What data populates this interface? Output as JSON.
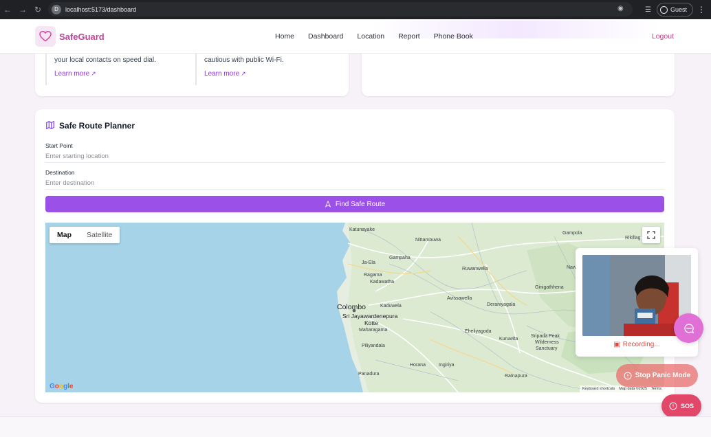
{
  "browser": {
    "url": "localhost:5173/dashboard",
    "profile_label": "Guest",
    "site_icon_letter": "D"
  },
  "header": {
    "brand": "SafeGuard",
    "nav": [
      "Home",
      "Dashboard",
      "Location",
      "Report",
      "Phone Book"
    ],
    "logout": "Logout",
    "brand_color": "#c2459c",
    "accent_color": "#9333ea"
  },
  "tips": [
    {
      "text": "your local contacts on speed dial.",
      "link": "Learn more"
    },
    {
      "text": "cautious with public Wi-Fi.",
      "link": "Learn more"
    }
  ],
  "planner": {
    "title": "Safe Route Planner",
    "start_label": "Start Point",
    "start_placeholder": "Enter starting location",
    "start_value": "",
    "dest_label": "Destination",
    "dest_placeholder": "Enter destination",
    "dest_value": "",
    "find_button": "Find Safe Route",
    "button_color": "#9b51e8"
  },
  "map": {
    "tabs": [
      "Map",
      "Satellite"
    ],
    "active_tab": "Map",
    "places": {
      "katunayake": "Katunayake",
      "nittambuwa": "Nittambuwa",
      "gampaha": "Gampaha",
      "ja_ela": "Ja-Ela",
      "ragama": "Ragama",
      "kadawatha": "Kadawatha",
      "ruwanwella": "Ruwanwella",
      "gampola": "Gampola",
      "rikillag": "Rikillag",
      "nawalapitiya": "Nawalapitiya",
      "ginigathhena": "Ginigathhena",
      "avissawella": "Avissawella",
      "deraniyagala": "Deraniyagala",
      "kaduwela": "Kaduwela",
      "colombo": "Colombo",
      "sri_jayawardenepura": "Sri Jayawardenepura",
      "kotte": "Kotte",
      "maharagama": "Maharagama",
      "eheliyagoda": "Eheliyagoda",
      "kuruwita": "Kuruwita",
      "sripada": "Sripada Peak",
      "wilderness": "Wilderness",
      "sanctuary": "Sanctuary",
      "piliyandala": "Piliyandala",
      "ingiriya": "Ingiriya",
      "horana": "Horana",
      "panadura": "Panadura",
      "ratnapura": "Ratnapura"
    },
    "google_logo": "Google",
    "attribution": [
      "Keyboard shortcuts",
      "Map data ©2025",
      "Terms"
    ],
    "water_color": "#a6d3e8",
    "land_color": "#e5eee0"
  },
  "recording": {
    "status": "Recording...",
    "status_color": "#e1453c"
  },
  "floating": {
    "stop_panic": "Stop Panic Mode",
    "sos": "SOS",
    "chat_color": "#e070d6",
    "sos_color": "#e24668"
  }
}
